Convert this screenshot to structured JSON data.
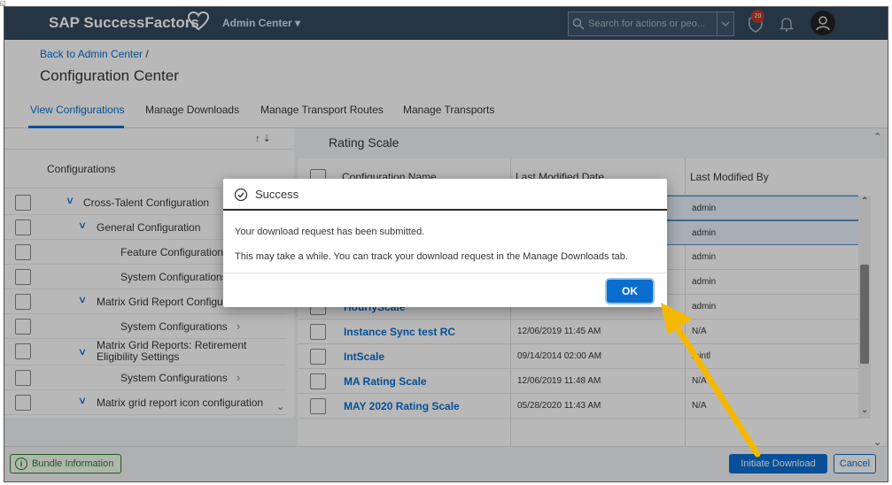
{
  "shell": {
    "brand": "SAP SuccessFactors",
    "menu": "Admin Center",
    "search_placeholder": "Search for actions or peo...",
    "notification_count": "20"
  },
  "header": {
    "breadcrumb": "Back to Admin Center",
    "breadcrumb_sep": "/",
    "title": "Configuration Center"
  },
  "tabs": [
    {
      "label": "View Configurations",
      "active": true
    },
    {
      "label": "Manage Downloads"
    },
    {
      "label": "Manage Transport Routes"
    },
    {
      "label": "Manage Transports"
    }
  ],
  "left_panel": {
    "sort_icons": "↑ ⇣",
    "column_header": "Configurations",
    "tree": [
      {
        "label": "Cross-Talent Configuration",
        "level": 0,
        "expanded": true
      },
      {
        "label": "General Configuration",
        "level": 1,
        "expanded": true
      },
      {
        "label": "Feature Configurations",
        "level": 2
      },
      {
        "label": "System Configurations",
        "level": 2
      },
      {
        "label": "Matrix Grid Report Configur",
        "level": 1,
        "expanded": true
      },
      {
        "label": "System Configurations",
        "level": 2
      },
      {
        "label": "Matrix Grid Reports: Retirement",
        "label2": "Eligibility Settings",
        "level": 1,
        "expanded": true
      },
      {
        "label": "System Configurations",
        "level": 2
      },
      {
        "label": "Matrix grid report icon configuration",
        "level": 1,
        "expanded": true
      }
    ]
  },
  "right_panel": {
    "title": "Rating Scale",
    "columns": [
      "Configuration Name",
      "Last Modified Date",
      "Last Modified By"
    ],
    "rows": [
      {
        "name": "",
        "date": "",
        "by": "admin",
        "selected": true
      },
      {
        "name": "",
        "date": "",
        "by": "admin",
        "selected": true
      },
      {
        "name": "",
        "date": "",
        "by": "admin"
      },
      {
        "name": "",
        "date": "",
        "by": "admin"
      },
      {
        "name": "HourlyScale",
        "date": "",
        "by": "admin"
      },
      {
        "name": "Instance Sync test RC",
        "date": "12/06/2019 11:45 AM",
        "by": "N/A"
      },
      {
        "name": "IntScale",
        "date": "09/14/2014 02:00 AM",
        "by": "mintl"
      },
      {
        "name": "MA Rating Scale",
        "date": "12/06/2019 11:48 AM",
        "by": "N/A"
      },
      {
        "name": "MAY 2020 Rating Scale",
        "date": "05/28/2020 11:43 AM",
        "by": "N/A"
      }
    ]
  },
  "footer": {
    "bundle_label": "Bundle Information",
    "initiate_label": "Initiate Download",
    "cancel_label": "Cancel"
  },
  "dialog": {
    "title": "Success",
    "message1": "Your download request has been submitted.",
    "message2": "This may take a while. You can track your download request in the Manage Downloads tab.",
    "ok_label": "OK"
  },
  "colors": {
    "shell": "#354a5f",
    "accent": "#0a6ed1",
    "arrow": "#f5b800",
    "bundle_green": "#2b7d2b"
  }
}
